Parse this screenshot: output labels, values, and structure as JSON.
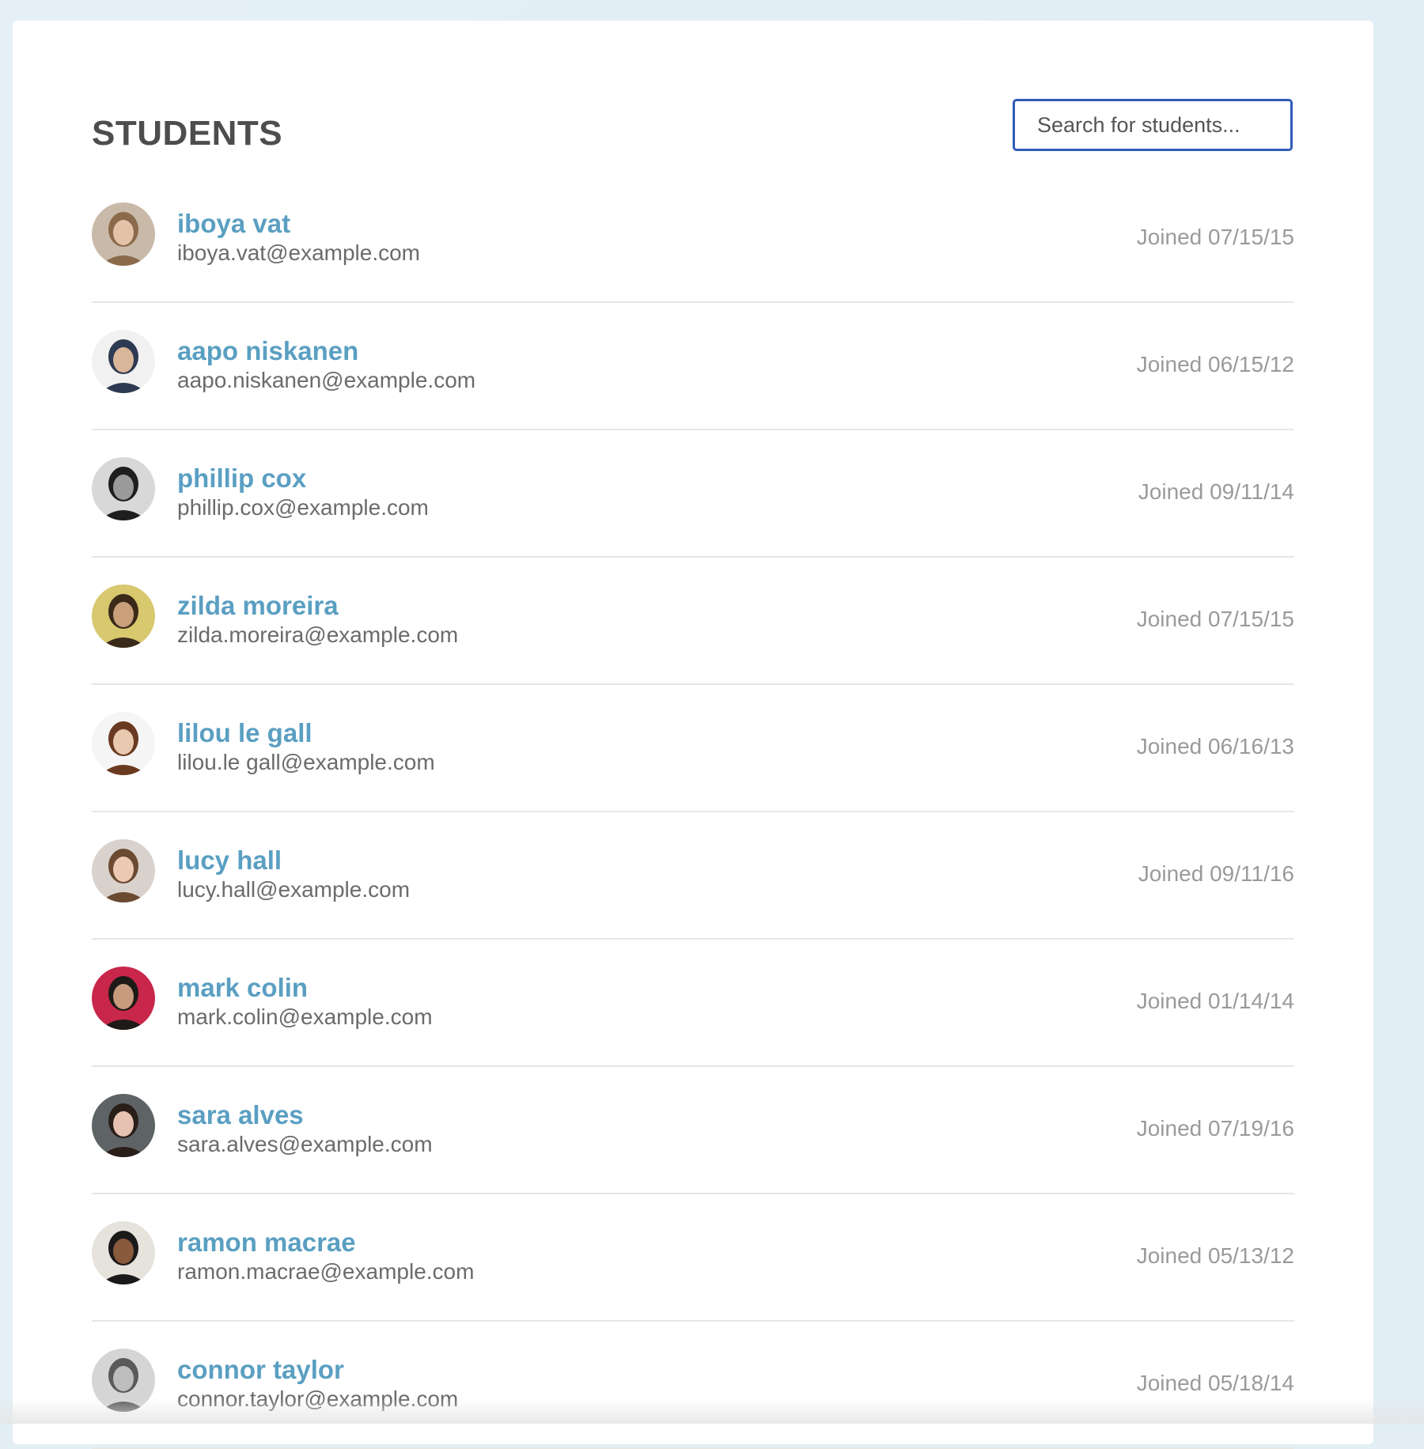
{
  "header": {
    "title": "STUDENTS"
  },
  "search": {
    "placeholder": "Search for students...",
    "value": ""
  },
  "students": [
    {
      "name": "iboya vat",
      "email": "iboya.vat@example.com",
      "joined": "Joined 07/15/15",
      "avatar_bg": "#c9b9a8",
      "avatar_skin": "#e3c2a8",
      "avatar_hair": "#8a6a4a"
    },
    {
      "name": "aapo niskanen",
      "email": "aapo.niskanen@example.com",
      "joined": "Joined 06/15/12",
      "avatar_bg": "#f1f1f1",
      "avatar_skin": "#d9b59a",
      "avatar_hair": "#2e3a52"
    },
    {
      "name": "phillip cox",
      "email": "phillip.cox@example.com",
      "joined": "Joined 09/11/14",
      "avatar_bg": "#d8d8d8",
      "avatar_skin": "#9a9a9a",
      "avatar_hair": "#1e1e1e"
    },
    {
      "name": "zilda moreira",
      "email": "zilda.moreira@example.com",
      "joined": "Joined 07/15/15",
      "avatar_bg": "#d8c86e",
      "avatar_skin": "#c9a07a",
      "avatar_hair": "#3a2a1a"
    },
    {
      "name": "lilou le gall",
      "email": "lilou.le gall@example.com",
      "joined": "Joined 06/16/13",
      "avatar_bg": "#f5f5f5",
      "avatar_skin": "#e9c8b0",
      "avatar_hair": "#6a3a20"
    },
    {
      "name": "lucy hall",
      "email": "lucy.hall@example.com",
      "joined": "Joined 09/11/16",
      "avatar_bg": "#d9d2cc",
      "avatar_skin": "#ecc9b2",
      "avatar_hair": "#6b4a32"
    },
    {
      "name": "mark colin",
      "email": "mark.colin@example.com",
      "joined": "Joined 01/14/14",
      "avatar_bg": "#c8264a",
      "avatar_skin": "#c89a7e",
      "avatar_hair": "#1e1a18"
    },
    {
      "name": "sara alves",
      "email": "sara.alves@example.com",
      "joined": "Joined 07/19/16",
      "avatar_bg": "#5e6466",
      "avatar_skin": "#e6c2b2",
      "avatar_hair": "#2a1e18"
    },
    {
      "name": "ramon macrae",
      "email": "ramon.macrae@example.com",
      "joined": "Joined 05/13/12",
      "avatar_bg": "#e6e2dc",
      "avatar_skin": "#8a5a3e",
      "avatar_hair": "#1a1a1a"
    },
    {
      "name": "connor taylor",
      "email": "connor.taylor@example.com",
      "joined": "Joined 05/18/14",
      "avatar_bg": "#d5d5d5",
      "avatar_skin": "#bdbdbd",
      "avatar_hair": "#5a5a5a"
    }
  ]
}
